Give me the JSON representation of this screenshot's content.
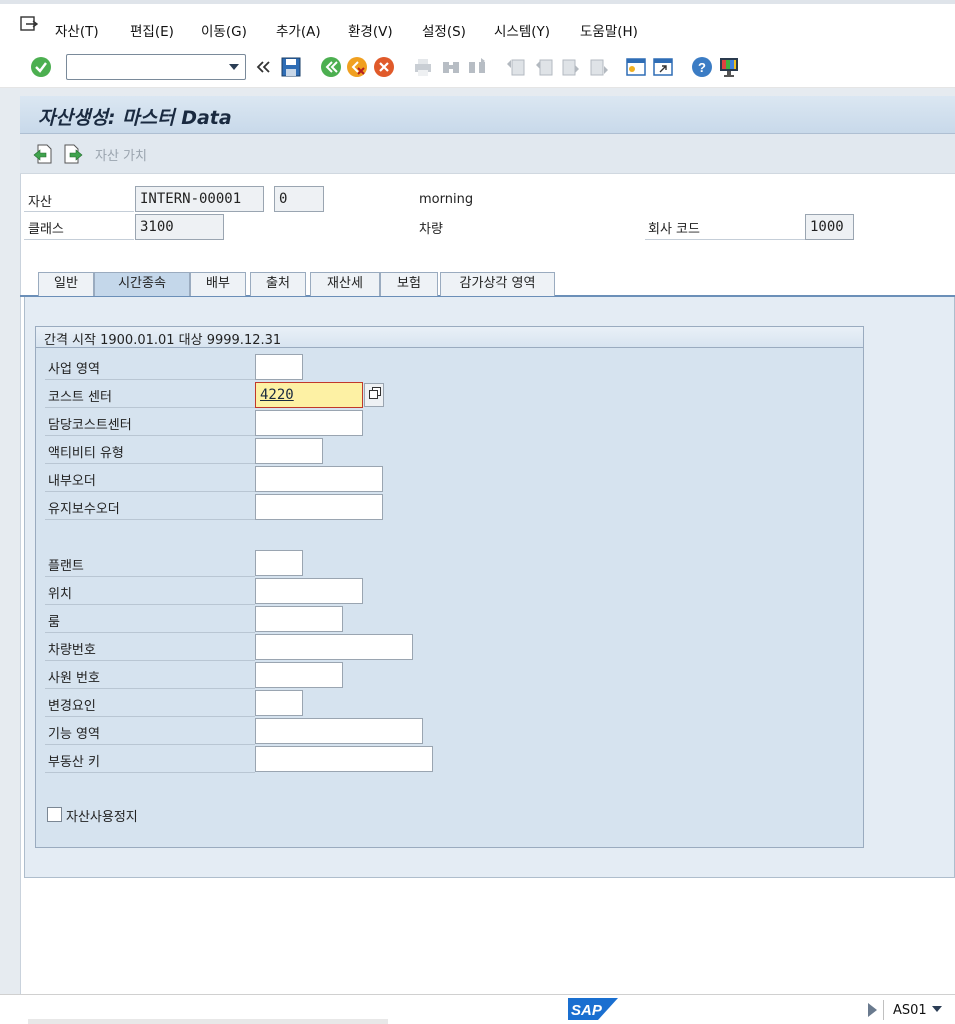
{
  "menubar": {
    "items": [
      "자산(T)",
      "편집(E)",
      "이동(G)",
      "추가(A)",
      "환경(V)",
      "설정(S)",
      "시스템(Y)",
      "도움말(H)"
    ]
  },
  "toolbar": {
    "command_value": "",
    "icons": [
      "enter-icon",
      "back-double-arrow-icon",
      "save-icon",
      "back-icon",
      "exit-icon",
      "cancel-icon",
      "print-icon",
      "find-icon",
      "find-next-icon",
      "first-page-icon",
      "previous-page-icon",
      "next-page-icon",
      "last-page-icon",
      "create-session-icon",
      "shortcut-icon",
      "help-icon",
      "customize-layout-icon"
    ]
  },
  "title": "자산생성: 마스터 Data",
  "app_toolbar": {
    "value_label": "자산 가치"
  },
  "header": {
    "asset_label": "자산",
    "asset_number": "INTERN-00001",
    "asset_sub": "0",
    "asset_desc": "morning",
    "class_label": "클래스",
    "class_value": "3100",
    "class_desc": "차량",
    "company_label": "회사 코드",
    "company_value": "1000"
  },
  "tabs": [
    {
      "label": "일반",
      "active": false
    },
    {
      "label": "시간종속",
      "active": true
    },
    {
      "label": "배부",
      "active": false
    },
    {
      "label": "출처",
      "active": false
    },
    {
      "label": "재산세",
      "active": false
    },
    {
      "label": "보험",
      "active": false
    },
    {
      "label": "감가상각 영역",
      "active": false
    }
  ],
  "group": {
    "title": "간격 시작 1900.01.01 대상 9999.12.31"
  },
  "fields": [
    {
      "label": "사업 영역",
      "value": ""
    },
    {
      "label": "코스트 센터",
      "value": "4220"
    },
    {
      "label": "담당코스트센터",
      "value": ""
    },
    {
      "label": "액티비티 유형",
      "value": ""
    },
    {
      "label": "내부오더",
      "value": ""
    },
    {
      "label": "유지보수오더",
      "value": ""
    },
    {
      "label": "플랜트",
      "value": ""
    },
    {
      "label": "위치",
      "value": ""
    },
    {
      "label": "룸",
      "value": ""
    },
    {
      "label": "차량번호",
      "value": ""
    },
    {
      "label": "사원 번호",
      "value": ""
    },
    {
      "label": "변경요인",
      "value": ""
    },
    {
      "label": "기능 영역",
      "value": ""
    },
    {
      "label": "부동산 키",
      "value": ""
    }
  ],
  "checkbox": {
    "label": "자산사용정지",
    "checked": false
  },
  "status": {
    "system": "AS01",
    "logo": "SAP"
  }
}
